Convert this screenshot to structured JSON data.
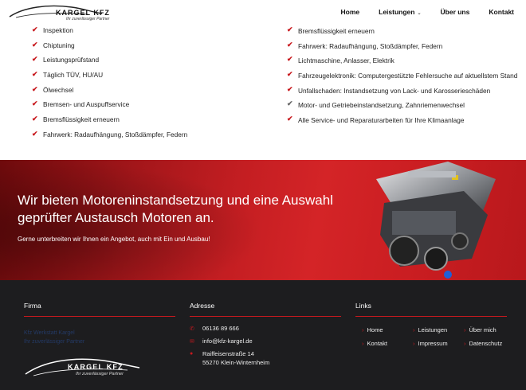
{
  "header": {
    "logo_brand": "KARGEL KFZ",
    "logo_tagline": "Ihr zuverlässiger Partner",
    "nav": [
      {
        "label": "Home"
      },
      {
        "label": "Leistungen"
      },
      {
        "label": "Über uns"
      },
      {
        "label": "Kontakt"
      }
    ]
  },
  "services_left": [
    "Inspektion",
    "Chiptuning",
    "Leistungsprüfstand",
    "Täglich TÜV, HU/AU",
    "Ölwechsel",
    "Bremsen- und Auspuffservice",
    "Bremsflüssigkeit erneuern",
    "Fahrwerk: Radaufhängung, Stoßdämpfer, Federn"
  ],
  "services_right": [
    "Bremsflüssigkeit erneuern",
    "Fahrwerk: Radaufhängung, Stoßdämpfer, Federn",
    "Lichtmaschine, Anlasser, Elektrik",
    "Fahrzeugelektronik: Computergestützte Fehlersuche auf aktuellstem Stand",
    "Unfallschaden: Instandsetzung von Lack- und Karosserieschäden",
    "Motor- und Getriebeinstandsetzung, Zahnriemenwechsel",
    "Alle Service- und Reparaturarbeiten für Ihre Klimaanlage"
  ],
  "banner": {
    "heading": "Wir bieten Motoreninstandsetzung und eine Auswahl geprüfter Austausch Motoren an.",
    "subtext": "Gerne unterbreiten wir Ihnen ein Angebot, auch mit Ein und Ausbau!"
  },
  "footer": {
    "firma_title": "Firma",
    "firma_text_1": "Kfz Werkstatt Kargel",
    "firma_text_2": "Ihr zuverlässiger Partner",
    "adresse_title": "Adresse",
    "phone": "06136 89 666",
    "email": "info@kfz-kargel.de",
    "street": "Raiffeisenstraße 14",
    "city": "55270 Klein-Winternheim",
    "links_title": "Links",
    "links": [
      "Home",
      "Leistungen",
      "Über mich",
      "Kontakt",
      "Impressum",
      "Datenschutz"
    ],
    "logo_brand": "KARGEL KFZ",
    "logo_tagline": "Ihr zuverlässiger Partner"
  },
  "colors": {
    "accent": "#c8191e",
    "footer_bg": "#1d1d1f"
  }
}
